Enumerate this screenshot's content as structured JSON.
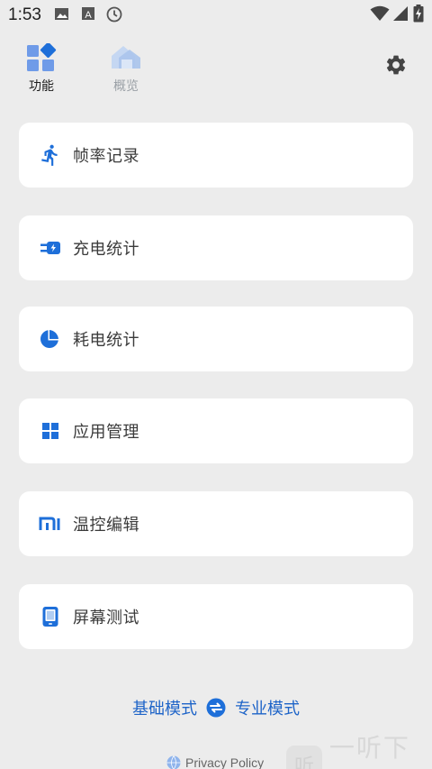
{
  "status_bar": {
    "time": "1:53",
    "left_icons": [
      "image-icon",
      "font-a-icon",
      "clock-icon"
    ],
    "right_icons": [
      "wifi-icon",
      "signal-icon",
      "battery-charging-icon"
    ]
  },
  "tabs": [
    {
      "label": "功能",
      "icon": "features-icon",
      "active": true
    },
    {
      "label": "概览",
      "icon": "overview-icon",
      "active": false
    }
  ],
  "settings_icon": "gear-icon",
  "cards": [
    {
      "label": "帧率记录",
      "icon": "running-icon"
    },
    {
      "label": "充电统计",
      "icon": "charging-plug-icon"
    },
    {
      "label": "耗电统计",
      "icon": "pie-chart-icon"
    },
    {
      "label": "应用管理",
      "icon": "apps-grid-icon"
    },
    {
      "label": "温控编辑",
      "icon": "mi-logo-icon"
    },
    {
      "label": "屏幕测试",
      "icon": "phone-screen-icon"
    }
  ],
  "mode": {
    "basic_label": "基础模式",
    "pro_label": "专业模式",
    "swap_icon": "swap-icon"
  },
  "privacy": {
    "label": "Privacy Policy",
    "icon": "globe-icon"
  },
  "watermark": {
    "badge": "听",
    "text": "一听下载"
  },
  "colors": {
    "accent": "#1e6fd9",
    "background": "#ececec",
    "card": "#ffffff"
  }
}
